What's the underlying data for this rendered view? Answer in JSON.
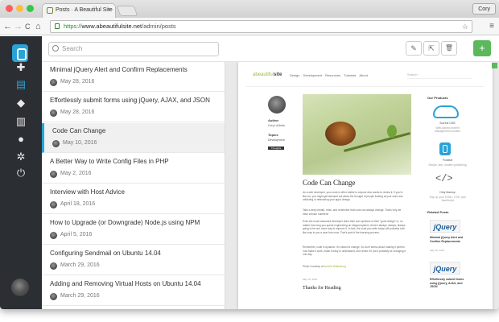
{
  "browser": {
    "tab_title": "Posts · A Beautiful Site",
    "tab_close": "×",
    "profile": "Cory",
    "url_scheme": "https://",
    "url_host": "www.abeautifulsite.net",
    "url_path": "/admin/posts",
    "nav_back": "←",
    "nav_forward": "→",
    "nav_reload": "C",
    "nav_home": "⌂",
    "star": "☆",
    "menu": "≡",
    "traffic_colors": [
      "#fc605c",
      "#fdbc40",
      "#34c84a"
    ]
  },
  "sidebar": {
    "icons": [
      "plus-icon",
      "document-icon",
      "tag-icon",
      "map-icon",
      "user-icon",
      "gear-icon",
      "power-icon"
    ],
    "glyphs": [
      "✚",
      "▤",
      "◆",
      "▥",
      "●",
      "✲",
      "⏻"
    ],
    "active_index": 1,
    "accent": "#29a3d6",
    "bg": "#2b2f33"
  },
  "search": {
    "placeholder": "Search"
  },
  "toolbar": {
    "edit_glyph": "✎",
    "open_glyph": "⇱",
    "delete_glyph": "🗑",
    "add_glyph": "+",
    "add_color": "#5cb85c"
  },
  "posts": [
    {
      "title": "Minimal jQuery Alert and Confirm Replacements",
      "date": "May 28, 2016",
      "selected": false
    },
    {
      "title": "Effortlessly submit forms using jQuery, AJAX, and JSON",
      "date": "May 28, 2016",
      "selected": false
    },
    {
      "title": "Code Can Change",
      "date": "May 10, 2016",
      "selected": true
    },
    {
      "title": "A Better Way to Write Config Files in PHP",
      "date": "May 2, 2016",
      "selected": false
    },
    {
      "title": "Interview with Host Advice",
      "date": "April 18, 2016",
      "selected": false
    },
    {
      "title": "How to Upgrade (or Downgrade) Node.js using NPM",
      "date": "April 5, 2016",
      "selected": false
    },
    {
      "title": "Configuring Sendmail on Ubuntu 14.04",
      "date": "March 29, 2016",
      "selected": false
    },
    {
      "title": "Adding and Removing Virtual Hosts on Ubuntu 14.04",
      "date": "March 29, 2016",
      "selected": false
    }
  ],
  "preview": {
    "logo_a": "abeautiful",
    "logo_b": "site",
    "nav": [
      "Design",
      "Development",
      "Resources",
      "Tutorials",
      "About"
    ],
    "search": "Search",
    "author_label": "Author",
    "author_name": "Cory LaViska",
    "topics_label": "Topics",
    "topics_value": "Development",
    "tag": "Thoughts",
    "article_title": "Code Can Change",
    "paragraphs": [
      "As a web developer, your code is often visible to anyone who wants to review it. If you're like me, you might get stressed out about the thought of people looking at your work and criticizing or refactoring your app's design.",
      "Take a deep breath, relax, and remember that code can always change. That's why we have version numbers!",
      "Even the most seasoned developer fears their own opinions of their \"good design\" or, no matter how long you spend engineering an elegant system, there's always, always, always going to be one more way to improve it. In fact, the code you write today will probably look like crap to you a year from now. That's part of the learning process.",
      "Remember, code is dynamic. It's meant to change. So don't stress about making it perfect. Just make it work, make it easy to understand, and revise it if you'll probably be changing it one day."
    ],
    "photo_credit_label": "Photo Courtesy of",
    "photo_credit": "Andrew Wallenborg",
    "date": "May 10, 2016",
    "thanks": "Thanks for Reading",
    "products_title": "Our Products",
    "products": [
      {
        "name": "Surreal CMS",
        "desc": "Web-based content management solution"
      },
      {
        "name": "Postleaf",
        "desc": "Simple, fast, modern publishing"
      },
      {
        "name": "Dirty Markup",
        "desc": "Tidy up your HTML, CSS, and JavaScript"
      }
    ],
    "related_title": "Related Posts",
    "related": [
      {
        "logo": "jQuery",
        "title": "Minimal jQuery Alert and Confirm Replacements",
        "date": "May 28, 2016"
      },
      {
        "logo": "jQuery",
        "title": "Effortlessly submit forms using jQuery, AJAX, and JSON",
        "date": "May 28, 2016"
      }
    ]
  }
}
